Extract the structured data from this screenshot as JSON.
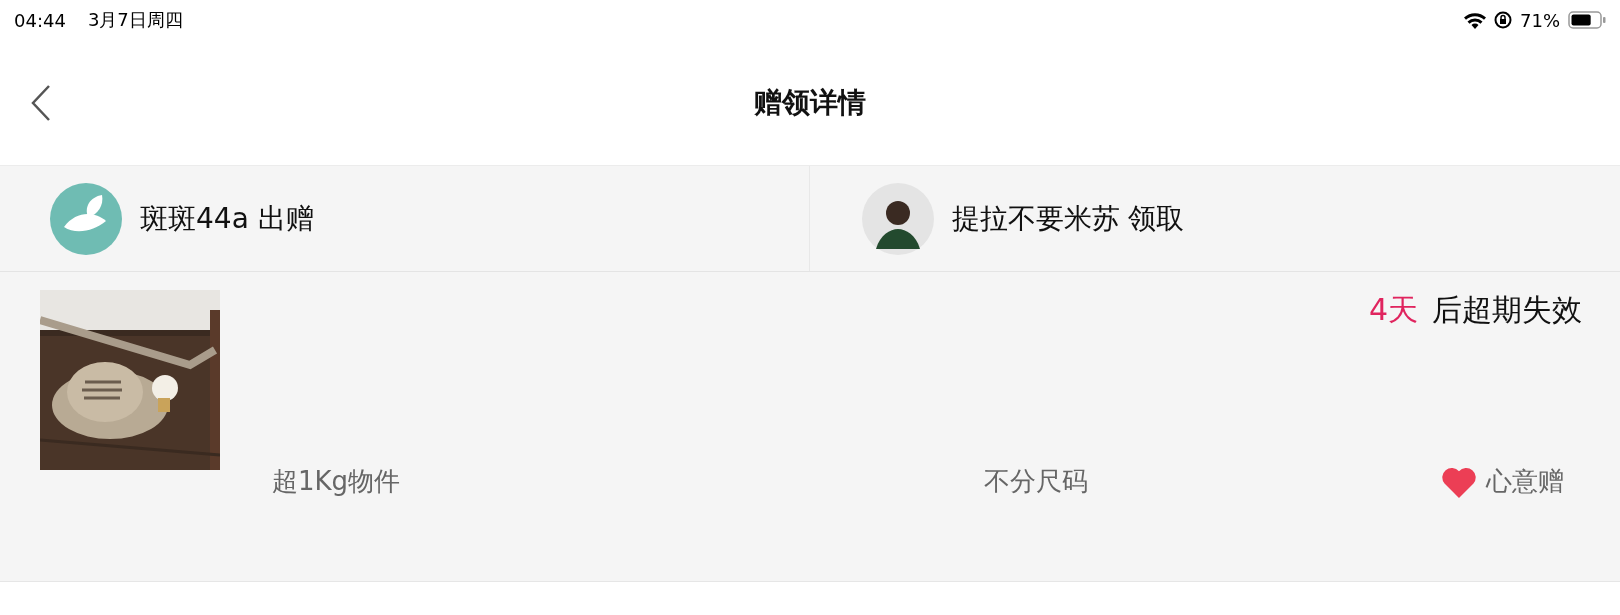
{
  "status_bar": {
    "time": "04:44",
    "date": "3月7日周四",
    "battery_percent": "71%",
    "battery": {
      "level": 0.71
    }
  },
  "nav": {
    "title": "赠领详情"
  },
  "parties": [
    {
      "kind": "logo",
      "text": "斑斑44a 出赠"
    },
    {
      "kind": "person",
      "text": "提拉不要米苏 领取"
    }
  ],
  "item": {
    "expiry_days": "4天",
    "expiry_text": "后超期失效",
    "weight": "超1Kg物件",
    "size": "不分尺码",
    "gift_type": "心意赠"
  }
}
